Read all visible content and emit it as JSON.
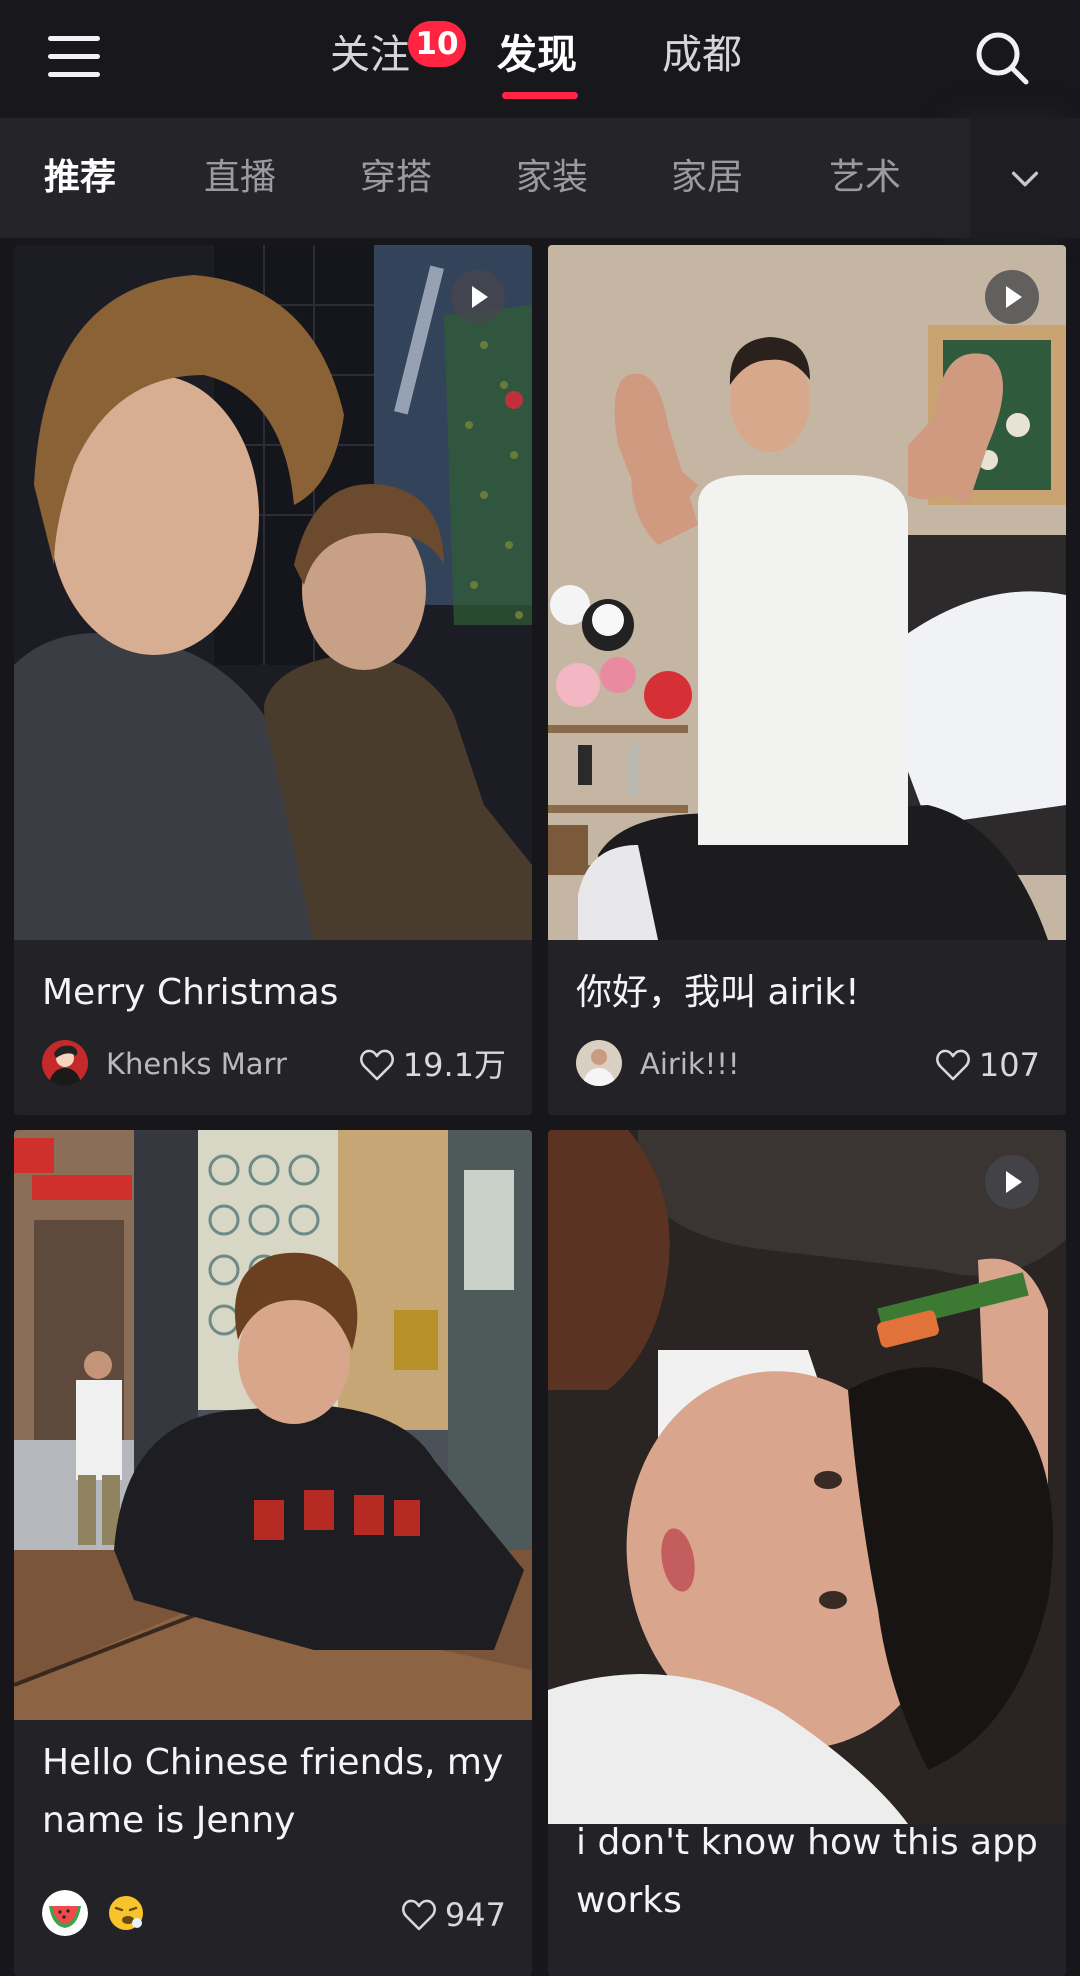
{
  "header": {
    "tabs": [
      {
        "label": "关注",
        "badge": "10"
      },
      {
        "label": "发现",
        "active": true
      },
      {
        "label": "成都"
      }
    ]
  },
  "categories": [
    "推荐",
    "直播",
    "穿搭",
    "家装",
    "家居",
    "艺术"
  ],
  "colors": {
    "accent": "#ff2442",
    "background": "#16161b",
    "card": "#222227"
  },
  "icons": [
    "menu-icon",
    "search-icon",
    "chevron-down-icon",
    "play-icon",
    "heart-icon",
    "watermelon-avatar-icon",
    "sneeze-emoji-icon"
  ],
  "feed": [
    {
      "title": "Merry Christmas",
      "author": "Khenks Marr",
      "likes": "19.1万",
      "video": true
    },
    {
      "title": "你好，我叫 airik!",
      "author": "Airik!!!",
      "likes": "107",
      "video": true
    },
    {
      "title": "Hello Chinese friends, my name is Jenny",
      "author": "",
      "likes": "947",
      "video": false
    },
    {
      "title": "i don't know how this app works",
      "video": true
    }
  ]
}
